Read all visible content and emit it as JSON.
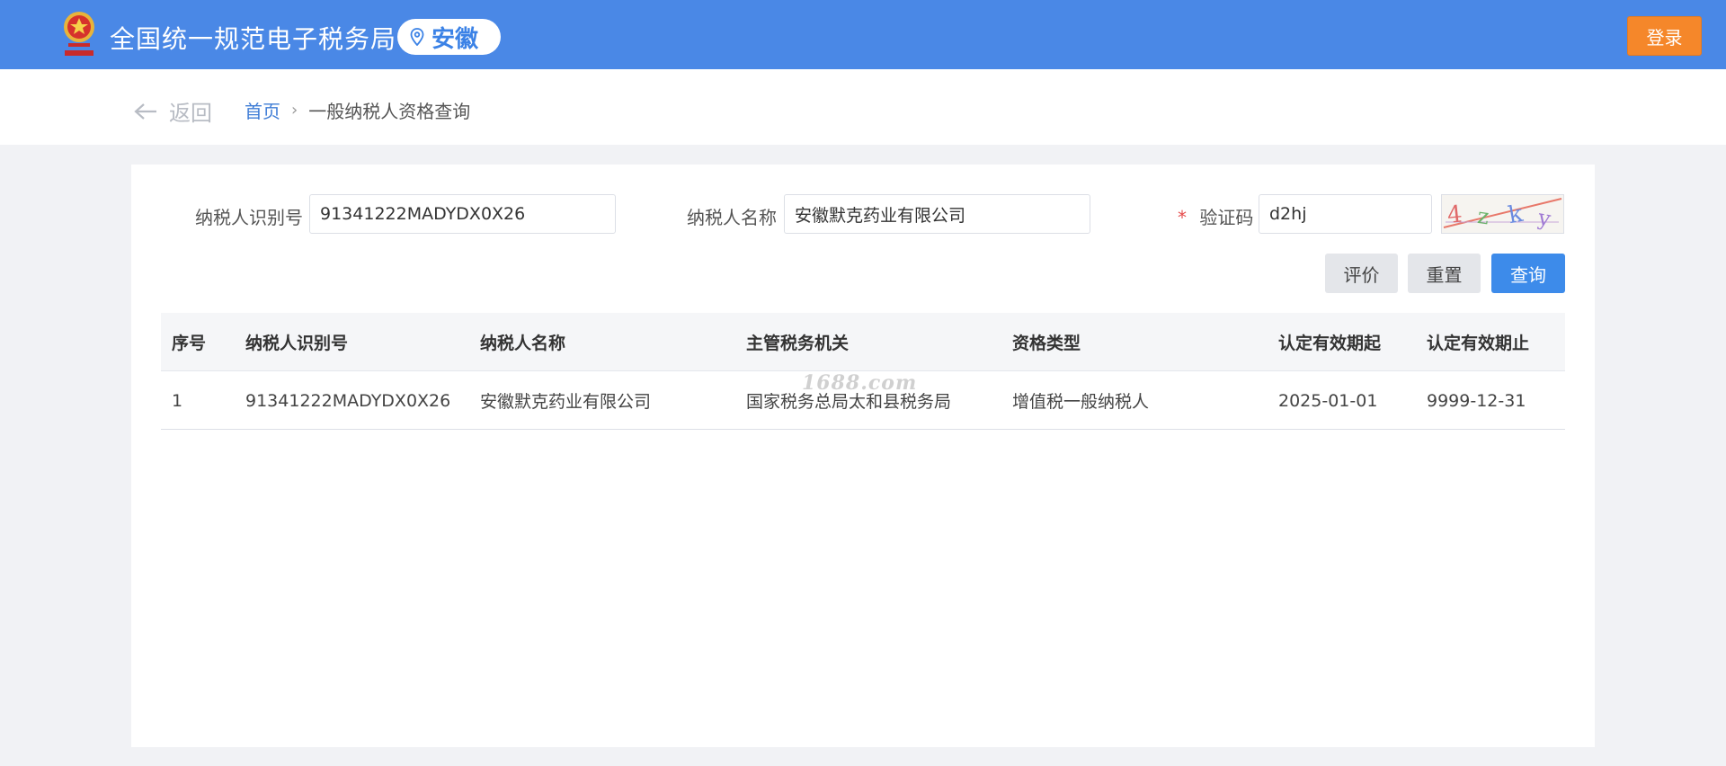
{
  "header": {
    "site_title": "全国统一规范电子税务局",
    "region": "安徽",
    "login_label": "登录",
    "accent_color": "#4a88e6"
  },
  "crumb": {
    "back_label": "返回",
    "home": "首页",
    "current": "一般纳税人资格查询"
  },
  "form": {
    "taxpayer_id_label": "纳税人识别号",
    "taxpayer_id_value": "91341222MADYDX0X26",
    "taxpayer_name_label": "纳税人名称",
    "taxpayer_name_value": "安徽默克药业有限公司",
    "captcha_required_mark": "*",
    "captcha_label": "验证码",
    "captcha_value": "d2hj",
    "captcha_image_text": "4zky"
  },
  "actions": {
    "evaluate": "评价",
    "reset": "重置",
    "query": "查询"
  },
  "table": {
    "headers": [
      "序号",
      "纳税人识别号",
      "纳税人名称",
      "主管税务机关",
      "资格类型",
      "认定有效期起",
      "认定有效期止"
    ],
    "rows": [
      [
        "1",
        "91341222MADYDX0X26",
        "安徽默克药业有限公司",
        "国家税务总局太和县税务局",
        "增值税一般纳税人",
        "2025-01-01",
        "9999-12-31"
      ]
    ]
  },
  "watermark": "1688.com"
}
